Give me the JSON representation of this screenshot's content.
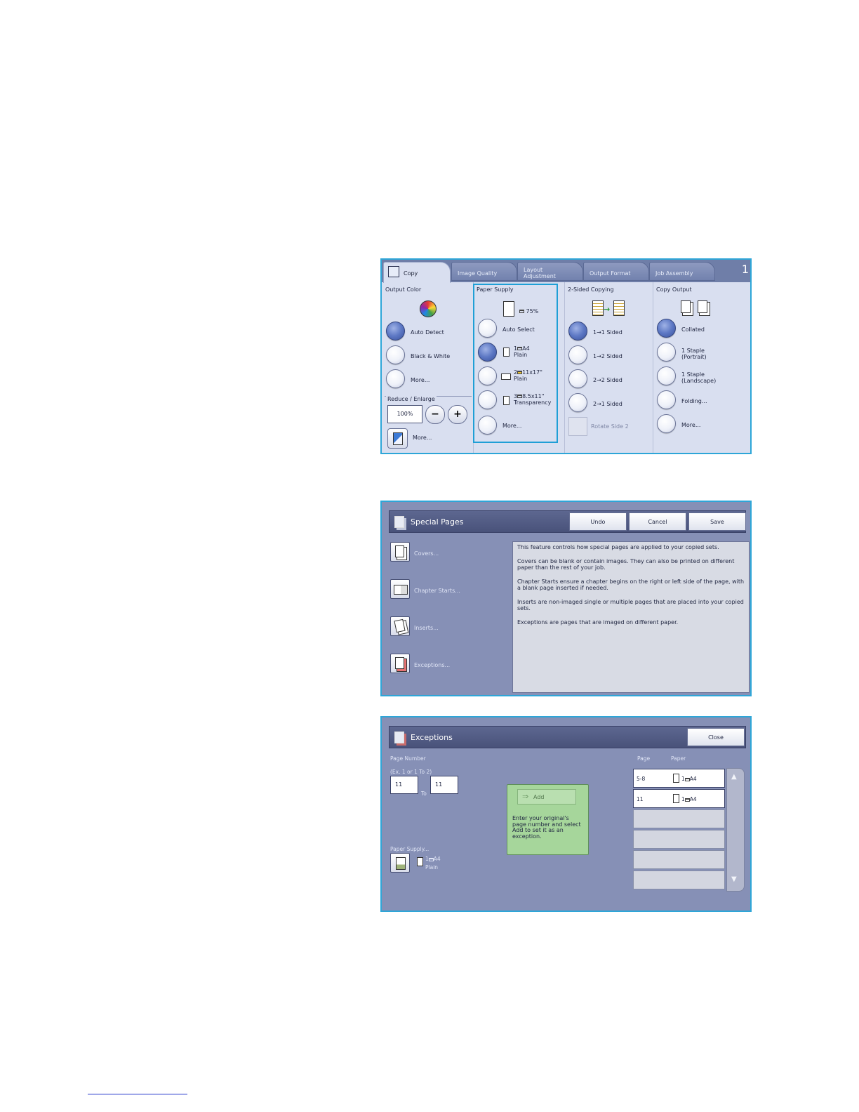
{
  "copy_screen": {
    "tabs": [
      {
        "label": "Copy"
      },
      {
        "label": "Image Quality"
      },
      {
        "label": "Layout Adjustment"
      },
      {
        "label": "Output Format"
      },
      {
        "label": "Job Assembly"
      }
    ],
    "tab_number": "1",
    "output_color": {
      "heading": "Output Color",
      "options": [
        "Auto Detect",
        "Black & White",
        "More..."
      ],
      "selected": "Auto Detect"
    },
    "reduce_enlarge": {
      "heading": "Reduce / Enlarge",
      "value": "100%",
      "minus": "−",
      "plus": "+",
      "more": "More..."
    },
    "paper_supply": {
      "heading": "Paper Supply",
      "auto_reduce": "75%",
      "options": [
        {
          "label": "Auto Select"
        },
        {
          "tray": "1",
          "size": "A4",
          "type": "Plain"
        },
        {
          "tray": "2",
          "size": "11x17\"",
          "type": "Plain"
        },
        {
          "tray": "3",
          "size": "8.5x11\"",
          "type": "Transparency"
        },
        {
          "label": "More..."
        }
      ],
      "selected_index": 1
    },
    "two_sided": {
      "heading": "2-Sided Copying",
      "options": [
        "1→1 Sided",
        "1→2 Sided",
        "2→2 Sided",
        "2→1 Sided"
      ],
      "rotate": "Rotate Side 2",
      "selected": "1→1 Sided"
    },
    "copy_output": {
      "heading": "Copy Output",
      "options": [
        "Collated",
        "1 Staple (Portrait)",
        "1 Staple (Landscape)",
        "Folding...",
        "More..."
      ],
      "selected": "Collated"
    }
  },
  "special_pages": {
    "title": "Special Pages",
    "buttons": {
      "undo": "Undo",
      "cancel": "Cancel",
      "save": "Save"
    },
    "items": [
      "Covers...",
      "Chapter Starts...",
      "Inserts...",
      "Exceptions..."
    ],
    "info": [
      "This feature controls how special pages are applied to your copied sets.",
      "Covers can be blank or contain images. They can also be printed on different paper than the rest of your job.",
      "Chapter Starts  ensure a chapter begins on the right or left side of the page, with a blank page inserted if needed.",
      "Inserts  are non-imaged single or multiple pages that are placed into your copied sets.",
      "Exceptions  are pages that are imaged on different paper."
    ]
  },
  "exceptions": {
    "title": "Exceptions",
    "close": "Close",
    "page_number_label": "Page Number",
    "example": "(Ex. 1 or 1 To 2)",
    "from_value": "11",
    "to_label": "To",
    "to_value": "11",
    "add_label": "Add",
    "add_help": "Enter your original's page number and select Add to set it as an exception.",
    "paper_supply_label": "Paper Supply...",
    "paper_tray": "1",
    "paper_size": "A4",
    "paper_type": "Plain",
    "columns": [
      "Page",
      "Paper"
    ],
    "rows": [
      {
        "page": "5-8",
        "tray": "1",
        "size": "A4"
      },
      {
        "page": "11",
        "tray": "1",
        "size": "A4"
      }
    ]
  }
}
